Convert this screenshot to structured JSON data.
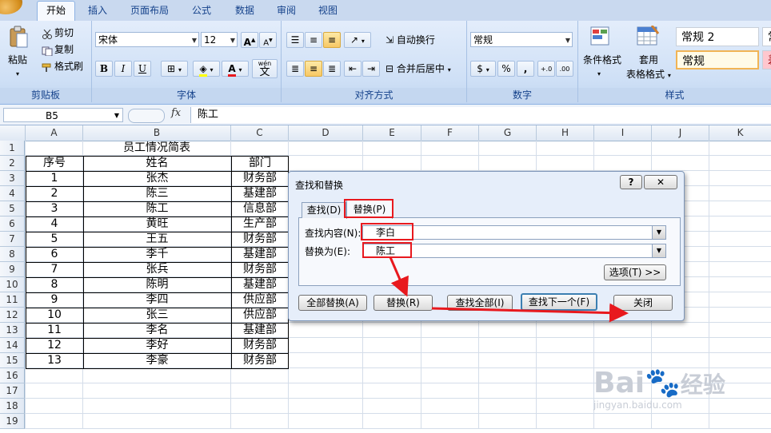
{
  "ribbon": {
    "tabs": [
      "开始",
      "插入",
      "页面布局",
      "公式",
      "数据",
      "审阅",
      "视图"
    ],
    "active_tab": "开始",
    "clipboard": {
      "paste": "粘贴",
      "cut": "剪切",
      "copy": "复制",
      "format_painter": "格式刷",
      "caption": "剪贴板"
    },
    "font": {
      "name": "宋体",
      "size": "12",
      "bold": "B",
      "italic": "I",
      "underline": "U",
      "grow": "A",
      "shrink": "A",
      "font_color": "A",
      "wen": "wén",
      "wen_char": "文",
      "caption": "字体"
    },
    "alignment": {
      "wrap": "自动换行",
      "merge": "合并后居中",
      "caption": "对齐方式"
    },
    "number": {
      "format": "常规",
      "percent": "%",
      "comma": ",",
      "inc_decimal": "+.0",
      "dec_decimal": ".00",
      "caption": "数字"
    },
    "styles": {
      "conditional": "条件格式",
      "table_format_1": "套用",
      "table_format_2": "表格格式",
      "style_normal2": "常规 2",
      "style_normal": "常规",
      "style_partial": "常",
      "style_partial2": "差",
      "caption": "样式"
    }
  },
  "formula_bar": {
    "name_box": "B5",
    "fx": "fx",
    "content": "陈工"
  },
  "columns": [
    "A",
    "B",
    "C",
    "D",
    "E",
    "F",
    "G",
    "H",
    "I",
    "J",
    "K"
  ],
  "rows": [
    "1",
    "2",
    "3",
    "4",
    "5",
    "6",
    "7",
    "8",
    "9",
    "10",
    "11",
    "12",
    "13",
    "14",
    "15",
    "16",
    "17",
    "18",
    "19"
  ],
  "sheet": {
    "title": "员工情况简表",
    "headers": [
      "序号",
      "姓名",
      "部门"
    ],
    "records": [
      [
        "1",
        "张杰",
        "财务部"
      ],
      [
        "2",
        "陈三",
        "基建部"
      ],
      [
        "3",
        "陈工",
        "信息部"
      ],
      [
        "4",
        "黄旺",
        "生产部"
      ],
      [
        "5",
        "王五",
        "财务部"
      ],
      [
        "6",
        "李千",
        "基建部"
      ],
      [
        "7",
        "张兵",
        "财务部"
      ],
      [
        "8",
        "陈明",
        "基建部"
      ],
      [
        "9",
        "李四",
        "供应部"
      ],
      [
        "10",
        "张三",
        "供应部"
      ],
      [
        "11",
        "李名",
        "基建部"
      ],
      [
        "12",
        "李好",
        "财务部"
      ],
      [
        "13",
        "李豪",
        "财务部"
      ]
    ]
  },
  "dialog": {
    "title": "查找和替换",
    "help": "?",
    "close_x": "✕",
    "tab_find": "查找(D)",
    "tab_replace": "替换(P)",
    "find_label": "查找内容(N):",
    "find_value": "李白",
    "replace_label": "替换为(E):",
    "replace_value": "陈工",
    "options": "选项(T) >>",
    "replace_all": "全部替换(A)",
    "replace": "替换(R)",
    "find_all": "查找全部(I)",
    "find_next": "查找下一个(F)",
    "close": "关闭"
  },
  "watermark": {
    "brand": "Bai",
    "brand2": "经验",
    "url": "jingyan.baidu.com"
  }
}
